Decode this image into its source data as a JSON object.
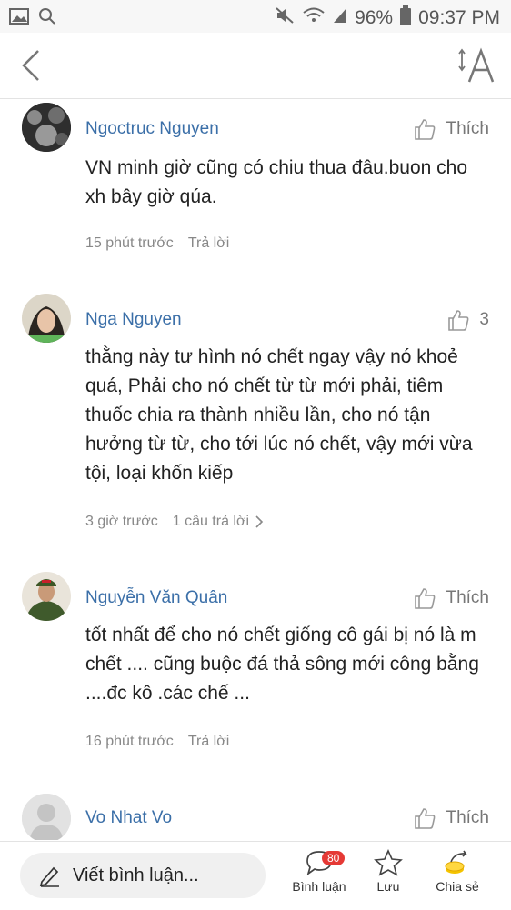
{
  "status": {
    "battery": "96%",
    "time": "09:37 PM"
  },
  "comments": [
    {
      "author": "Ngoctruc Nguyen",
      "like_label": "Thích",
      "text": "VN minh giờ cũng có chiu thua đâu.buon cho xh bây giờ qúa.",
      "time": "15 phút trước",
      "action": "Trả lời"
    },
    {
      "author": "Nga Nguyen",
      "like_label": "3",
      "text": "thằng này tư hình nó chết ngay vậy nó khoẻ quá, Phải cho nó chết từ từ mới phải, tiêm thuốc chia ra thành nhiều lần, cho nó tận hưởng từ từ, cho tới lúc nó chết, vậy mới vừa tội, loại khốn kiếp",
      "time": "3 giờ trước",
      "action": "1 câu trả lời"
    },
    {
      "author": "Nguyễn Văn Quân",
      "like_label": "Thích",
      "text": "tốt nhất để cho nó chết giống cô gái bị nó là m chết .... cũng buộc đá thả sông mới công bằng ....đc kô .các chế ...",
      "time": "16 phút trước",
      "action": "Trả lời"
    },
    {
      "author": "Vo Nhat Vo",
      "like_label": "Thích",
      "text": "",
      "time": "",
      "action": ""
    }
  ],
  "bottom": {
    "compose_placeholder": "Viết bình luận...",
    "comments_label": "Bình luận",
    "comments_count": "80",
    "save_label": "Lưu",
    "share_label": "Chia sẻ"
  }
}
